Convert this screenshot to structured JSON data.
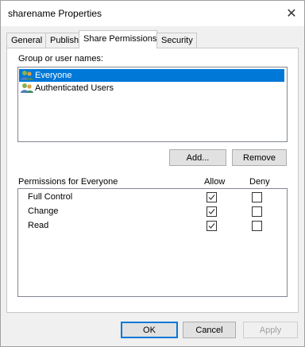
{
  "window": {
    "title": "sharename Properties",
    "close_glyph": "✕"
  },
  "tabs": [
    {
      "label": "General",
      "active": false
    },
    {
      "label": "Publish",
      "active": false
    },
    {
      "label": "Share Permissions",
      "active": true
    },
    {
      "label": "Security",
      "active": false
    }
  ],
  "group_section": {
    "label": "Group or user names:",
    "items": [
      {
        "name": "Everyone",
        "icon": "users-icon",
        "selected": true
      },
      {
        "name": "Authenticated Users",
        "icon": "users-icon",
        "selected": false
      }
    ],
    "add_button": "Add...",
    "remove_button": "Remove"
  },
  "permissions": {
    "label": "Permissions for Everyone",
    "allow_header": "Allow",
    "deny_header": "Deny",
    "rows": [
      {
        "name": "Full Control",
        "allow": true,
        "deny": false
      },
      {
        "name": "Change",
        "allow": true,
        "deny": false
      },
      {
        "name": "Read",
        "allow": true,
        "deny": false
      }
    ]
  },
  "footer": {
    "ok": "OK",
    "cancel": "Cancel",
    "apply": "Apply"
  },
  "colors": {
    "selection": "#0078d7",
    "window_bg": "#f0f0f0"
  }
}
